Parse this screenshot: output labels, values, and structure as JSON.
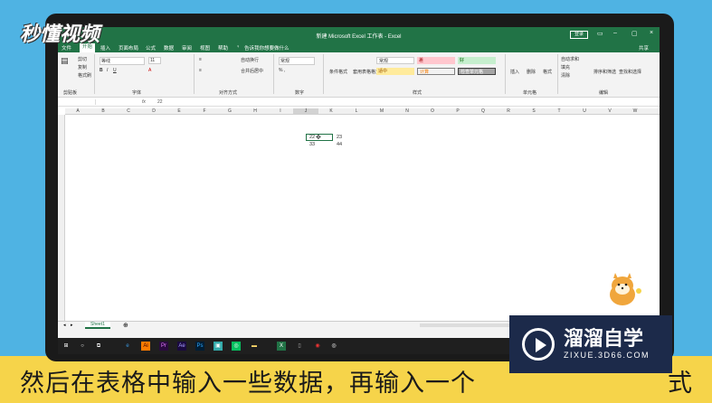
{
  "watermark": "秒懂视频",
  "window": {
    "title": "新建 Microsoft Excel 工作表 - Excel",
    "login": "登录",
    "user": "共享"
  },
  "tabs": [
    "文件",
    "开始",
    "插入",
    "页面布局",
    "公式",
    "数据",
    "审阅",
    "视图",
    "帮助"
  ],
  "active_tab": "开始",
  "tell_me": "告诉我你想要做什么",
  "ribbon": {
    "clipboard": {
      "cut": "剪切",
      "copy": "复制",
      "format_painter": "格式刷",
      "group": "剪贴板"
    },
    "font": {
      "name": "等线",
      "size": "11",
      "group": "字体"
    },
    "alignment": {
      "wrap": "自动换行",
      "merge": "合并后居中",
      "group": "对齐方式"
    },
    "number": {
      "format": "常规",
      "group": "数字"
    },
    "styles": {
      "conditional": "条件格式",
      "table": "套用表格格式",
      "normal": "常规",
      "bad": "差",
      "good": "好",
      "neutral": "适中",
      "calc": "计算",
      "check": "检查单元格",
      "group": "样式"
    },
    "cells": {
      "insert": "插入",
      "delete": "删除",
      "format": "格式",
      "group": "单元格"
    },
    "editing": {
      "autosum": "自动求和",
      "fill": "填充",
      "clear": "清除",
      "sort": "排序和筛选",
      "find": "查找和选择",
      "group": "编辑"
    }
  },
  "formula_bar": {
    "fx": "fx",
    "value": "22"
  },
  "columns": [
    "A",
    "B",
    "C",
    "D",
    "E",
    "F",
    "G",
    "H",
    "I",
    "J",
    "K",
    "L",
    "M",
    "N",
    "O",
    "P",
    "Q",
    "R",
    "S",
    "T",
    "U",
    "V",
    "W"
  ],
  "cells": {
    "j1": "22",
    "k1": "23",
    "j2": "33",
    "k2": "44"
  },
  "sheet_tab": "Sheet1",
  "caption": "然后在表格中输入一些数据，再输入一个",
  "caption_tail": "式",
  "brand": {
    "main": "溜溜自学",
    "sub": "ZIXUE.3D66.COM"
  }
}
